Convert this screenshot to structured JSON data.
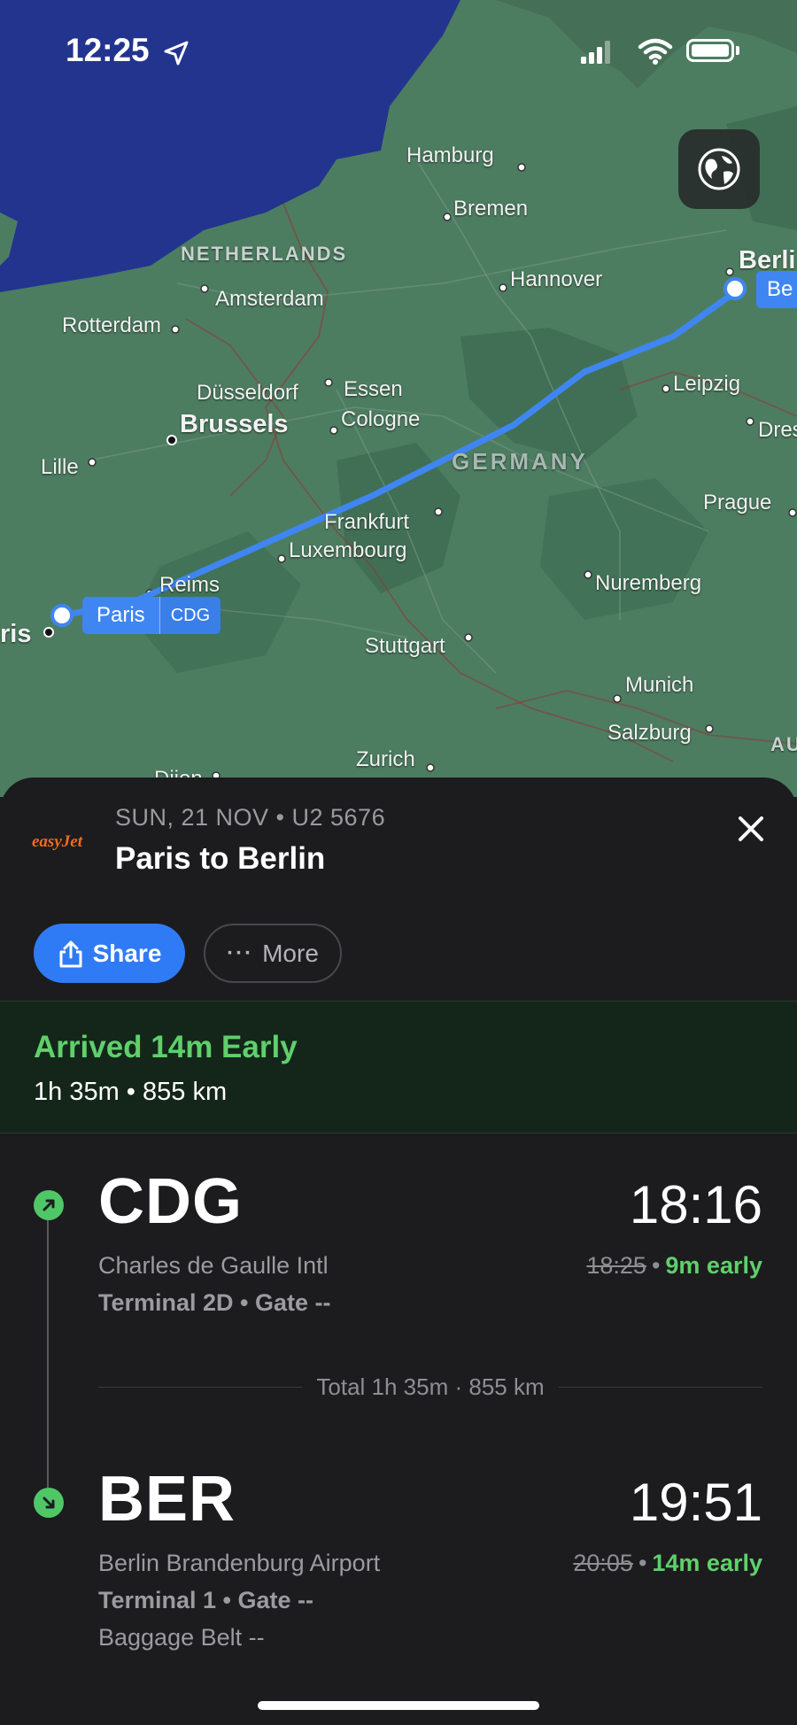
{
  "status_bar": {
    "time": "12:25"
  },
  "map": {
    "labels": {
      "hamburg": "Hamburg",
      "bremen": "Bremen",
      "netherlands": "NETHERLANDS",
      "amsterdam": "Amsterdam",
      "rotterdam": "Rotterdam",
      "hannover": "Hannover",
      "berlin": "Berli",
      "dusseldorf": "Düsseldorf",
      "essen": "Essen",
      "brussels": "Brussels",
      "cologne": "Cologne",
      "leipzig": "Leipzig",
      "dresden": "Dres",
      "lille": "Lille",
      "germany": "GERMANY",
      "prague": "Prague",
      "frankfurt": "Frankfurt",
      "luxembourg": "Luxembourg",
      "reims": "Reims",
      "nuremberg": "Nuremberg",
      "paris_partial": "ris",
      "stuttgart": "Stuttgart",
      "munich": "Munich",
      "salzburg": "Salzburg",
      "austria_partial": "AU",
      "zurich": "Zurich",
      "dijon": "Dijon"
    },
    "origin_pill": {
      "city": "Paris",
      "code": "CDG"
    },
    "dest_pill": {
      "city": "Be"
    },
    "globe_icon": "globe-icon"
  },
  "flight": {
    "airline": "easyJet",
    "meta": "SUN, 21 NOV • U2 5676",
    "title": "Paris to Berlin",
    "share_label": "Share",
    "more_label": "More",
    "status": "Arrived 14m Early",
    "duration": "1h 35m • 855 km",
    "departure": {
      "code": "CDG",
      "time": "18:16",
      "airport": "Charles de Gaulle Intl",
      "gate": "Terminal 2D • Gate --",
      "scheduled": "18:25",
      "early": "9m early"
    },
    "total": "Total 1h 35m · 855 km",
    "arrival": {
      "code": "BER",
      "time": "19:51",
      "airport": "Berlin Brandenburg Airport",
      "gate": "Terminal 1 • Gate --",
      "baggage": "Baggage Belt --",
      "scheduled": "20:05",
      "early": "14m early"
    }
  },
  "colors": {
    "accent": "#2f7bf5",
    "success": "#5fd06b",
    "sheet_bg": "#1c1c1e",
    "water": "#23348f",
    "land": "#4d7d61",
    "route": "#3f86f2",
    "airline": "#f26b1d"
  }
}
